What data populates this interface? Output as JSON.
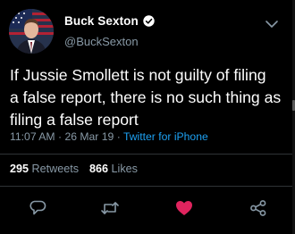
{
  "author": {
    "display_name": "Buck Sexton",
    "handle": "@BuckSexton",
    "verified": true
  },
  "tweet": {
    "text": "If Jussie Smollett is not guilty of filing\na false report, there is no such thing as\nfiling a false report",
    "time": "11:07 AM",
    "date": "26 Mar 19",
    "separator": "·",
    "source": "Twitter for iPhone"
  },
  "stats": {
    "retweets_count": "295",
    "retweets_label": "Retweets",
    "likes_count": "866",
    "likes_label": "Likes"
  },
  "actions": [
    {
      "icon": "reply-icon"
    },
    {
      "icon": "retweet-icon"
    },
    {
      "icon": "heart-icon",
      "liked": true
    },
    {
      "icon": "share-icon"
    }
  ],
  "colors": {
    "background": "#000000",
    "text": "#ffffff",
    "secondary": "#8899a6",
    "link": "#1da1f2",
    "like": "#e0245e",
    "divider": "#2f3336"
  }
}
